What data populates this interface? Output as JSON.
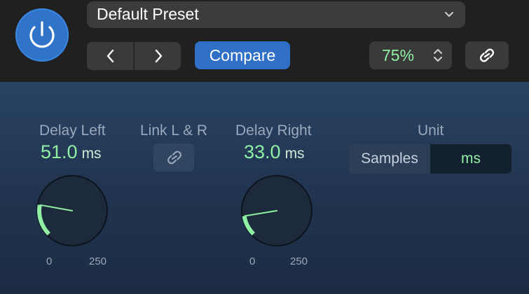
{
  "toolbar": {
    "preset_name": "Default Preset",
    "compare_label": "Compare",
    "zoom_value": "75%"
  },
  "controls": {
    "delay_left": {
      "label": "Delay Left",
      "value": "51.0",
      "unit": "ms",
      "min_label": "0",
      "max_label": "250",
      "min": 0,
      "max": 250,
      "current": 51.0
    },
    "link_lr": {
      "label": "Link L & R"
    },
    "delay_right": {
      "label": "Delay Right",
      "value": "33.0",
      "unit": "ms",
      "min_label": "0",
      "max_label": "250",
      "min": 0,
      "max": 250,
      "current": 33.0
    },
    "unit": {
      "label": "Unit",
      "options": [
        "Samples",
        "ms"
      ],
      "selected": "ms"
    }
  },
  "colors": {
    "accent_blue": "#2f74c9",
    "value_green": "#8ff0a4",
    "panel_bg": "#223652"
  },
  "icons": {
    "power": "power-icon",
    "chevron_down": "chevron-down-icon",
    "prev": "chevron-left-icon",
    "next": "chevron-right-icon",
    "stepper": "up-down-chevron-icon",
    "link": "link-icon"
  }
}
